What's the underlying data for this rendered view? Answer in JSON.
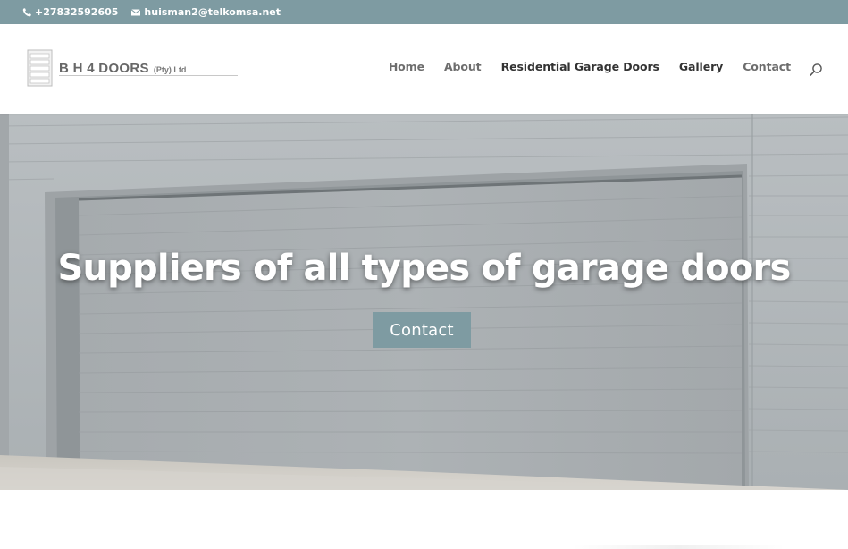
{
  "topbar": {
    "phone": "+27832592605",
    "email": "huisman2@telkomsa.net",
    "phone_icon": "phone-icon",
    "email_icon": "envelope-icon",
    "background": "#7e9ba2"
  },
  "header": {
    "logo_name": "B H 4 DOORS",
    "logo_sub": "(Pty) Ltd",
    "nav": [
      {
        "label": "Home"
      },
      {
        "label": "About"
      },
      {
        "label": "Residential Garage Doors"
      },
      {
        "label": "Gallery"
      },
      {
        "label": "Contact"
      }
    ],
    "search_icon": "search-icon"
  },
  "hero": {
    "title": "Suppliers of all types of garage doors",
    "button_label": "Contact",
    "button_color": "#7e9ba2"
  }
}
